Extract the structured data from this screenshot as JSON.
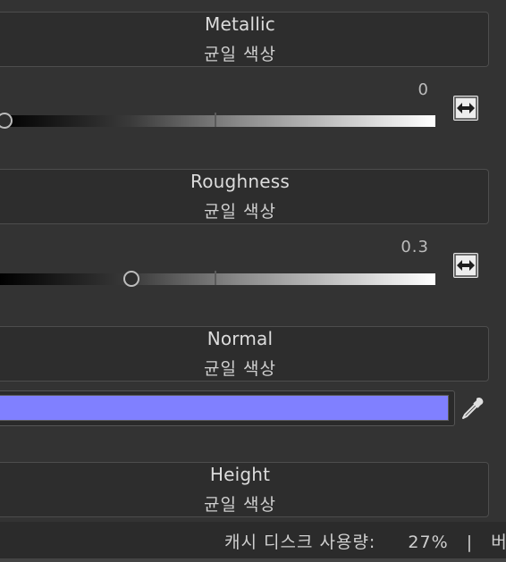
{
  "channels": [
    {
      "title": "Metallic",
      "mode": "균일 색상"
    },
    {
      "title": "Roughness",
      "mode": "균일 색상"
    },
    {
      "title": "Normal",
      "mode": "균일 색상"
    },
    {
      "title": "Height",
      "mode": "균일 색상"
    }
  ],
  "metallic_slider": {
    "value_label": "0",
    "value": 0.0
  },
  "roughness_slider": {
    "value_label": "0.3",
    "value": 0.3
  },
  "normal_color": {
    "hex": "#8080ff"
  },
  "icons": {
    "swap": "swap-arrows-icon",
    "eyedropper": "eyedropper-icon"
  },
  "status_bar": {
    "cache_label": "캐시 디스크 사용량:",
    "cache_value": "27%",
    "separator": "|",
    "truncated": "버"
  }
}
